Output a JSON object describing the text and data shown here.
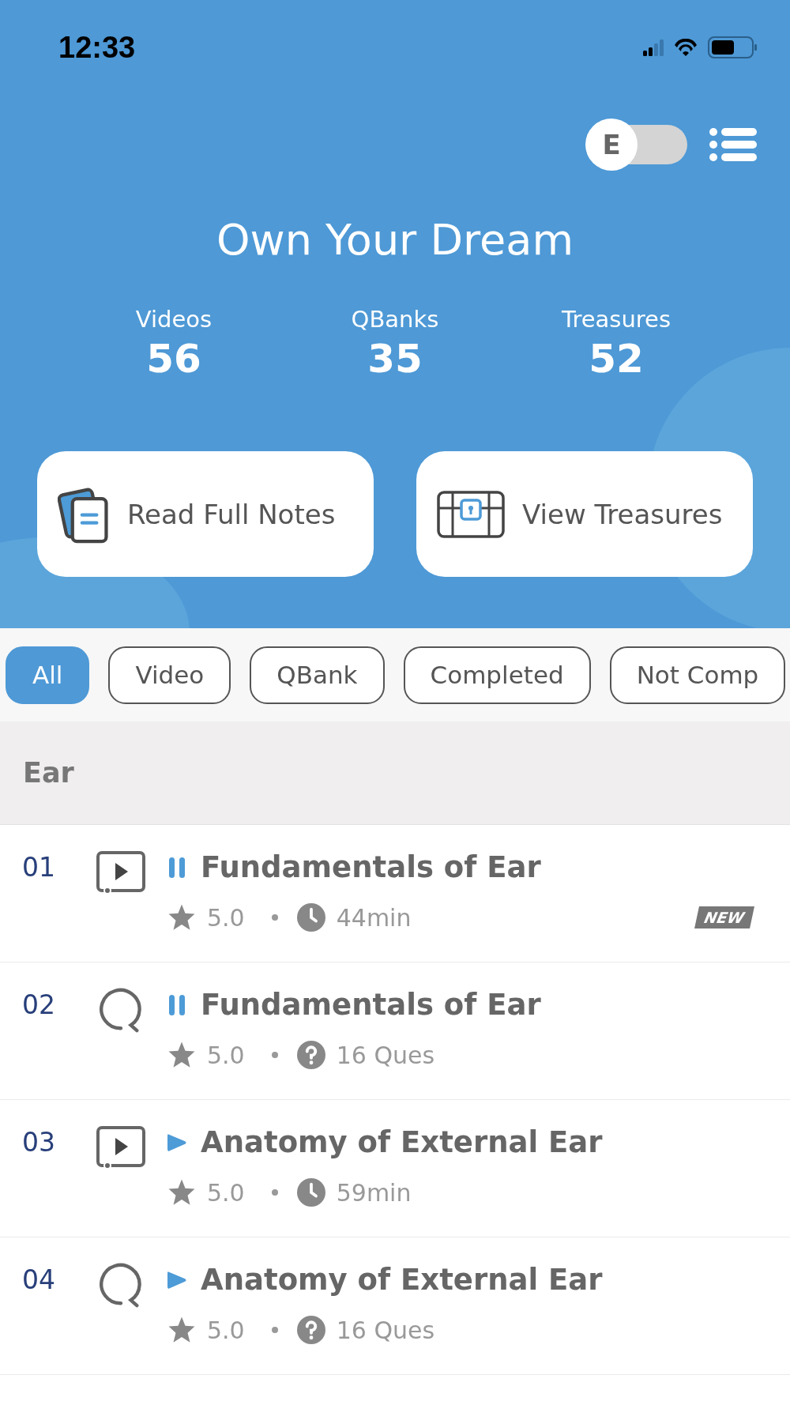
{
  "status_bar": {
    "time": "12:33"
  },
  "header": {
    "language_toggle": {
      "label": "E",
      "on": false
    },
    "title": "Own Your Dream",
    "stats": [
      {
        "label": "Videos",
        "value": "56"
      },
      {
        "label": "QBanks",
        "value": "35"
      },
      {
        "label": "Treasures",
        "value": "52"
      }
    ],
    "actions": [
      {
        "kind": "notes",
        "label": "Read Full Notes"
      },
      {
        "kind": "treasure",
        "label": "View Treasures"
      }
    ]
  },
  "filters": [
    {
      "label": "All",
      "selected": true
    },
    {
      "label": "Video",
      "selected": false
    },
    {
      "label": "QBank",
      "selected": false
    },
    {
      "label": "Completed",
      "selected": false
    },
    {
      "label": "Not Comp",
      "selected": false
    }
  ],
  "section": {
    "title": "Ear"
  },
  "items": [
    {
      "number": "01",
      "kind": "video",
      "in_progress": true,
      "title": "Fundamentals of Ear",
      "rating": "5.0",
      "detail": "44min",
      "new": true,
      "badge": "NEW"
    },
    {
      "number": "02",
      "kind": "qbank",
      "in_progress": true,
      "title": "Fundamentals of Ear",
      "rating": "5.0",
      "detail": "16 Ques",
      "new": false
    },
    {
      "number": "03",
      "kind": "video",
      "in_progress": false,
      "title": "Anatomy of External Ear",
      "rating": "5.0",
      "detail": "59min",
      "new": false
    },
    {
      "number": "04",
      "kind": "qbank",
      "in_progress": false,
      "title": "Anatomy of External Ear",
      "rating": "5.0",
      "detail": "16 Ques",
      "new": false
    }
  ]
}
